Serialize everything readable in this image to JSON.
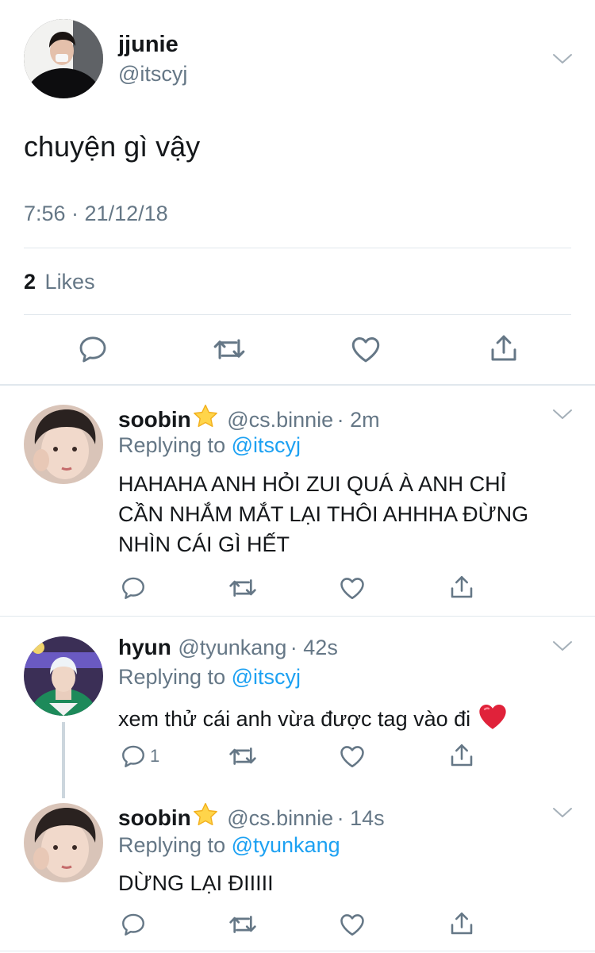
{
  "main_tweet": {
    "display_name": "jjunie",
    "handle": "@itscyj",
    "text": "chuyện gì vậy",
    "timestamp": "7:56 · 21/12/18",
    "likes_count": "2",
    "likes_label": "Likes"
  },
  "replies": [
    {
      "display_name": "soobin",
      "handle": "@cs.binnie",
      "time": "· 2m",
      "replying_label": "Replying to",
      "replying_to": "@itscyj",
      "text_lines": [
        "HAHAHA ANH HỎI ZUI QUÁ À ANH CHỈ",
        "CẦN NHẮM MẮT LẠI THÔI AHHHA ĐỪNG",
        "NHÌN CÁI GÌ HẾT"
      ]
    },
    {
      "display_name": "hyun",
      "handle": "@tyunkang",
      "time": "· 42s",
      "replying_label": "Replying to",
      "replying_to": "@itscyj",
      "text": "xem thử cái anh vừa được tag vào đi",
      "reply_count": "1"
    },
    {
      "display_name": "soobin",
      "handle": "@cs.binnie",
      "time": "· 14s",
      "replying_label": "Replying to",
      "replying_to": "@tyunkang",
      "text": "DỪNG LẠI ĐIIIII"
    }
  ],
  "icons": {
    "reply": "reply-icon",
    "retweet": "retweet-icon",
    "like": "heart-icon",
    "share": "share-icon",
    "more": "chevron-down-icon",
    "verified_star": "star-emoji",
    "heart_emoji": "red-heart-emoji"
  },
  "colors": {
    "text": "#14171a",
    "secondary": "#657786",
    "link": "#1da1f2",
    "divider": "#e1e8ed",
    "icon": "#657786"
  }
}
